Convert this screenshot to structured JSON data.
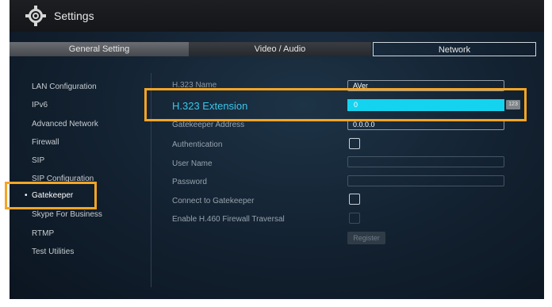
{
  "window": {
    "title": "Settings",
    "icon": "gear-icon"
  },
  "tabs": [
    {
      "label": "General Setting",
      "selected": false
    },
    {
      "label": "Video / Audio",
      "selected": false
    },
    {
      "label": "Network",
      "selected": true
    }
  ],
  "sidebar": {
    "items": [
      {
        "label": "LAN Configuration"
      },
      {
        "label": "IPv6"
      },
      {
        "label": "Advanced Network"
      },
      {
        "label": "Firewall"
      },
      {
        "label": "SIP"
      },
      {
        "label": "SIP Configuration"
      },
      {
        "label": "Gatekeeper",
        "active": true
      },
      {
        "label": "Skype For Business"
      },
      {
        "label": "RTMP"
      },
      {
        "label": "Test Utilities"
      }
    ]
  },
  "form": {
    "h323_name": {
      "label": "H.323 Name",
      "value": "AVer"
    },
    "h323_extension": {
      "label": "H.323 Extension",
      "value": "0",
      "input_badge": "123"
    },
    "gatekeeper_address": {
      "label": "Gatekeeper Address",
      "value": "0.0.0.0"
    },
    "authentication": {
      "label": "Authentication",
      "checked": false
    },
    "user_name": {
      "label": "User Name",
      "value": ""
    },
    "password": {
      "label": "Password",
      "value": ""
    },
    "connect_to_gatekeeper": {
      "label": "Connect to Gatekeeper",
      "checked": false
    },
    "enable_h460": {
      "label": "Enable H.460 Firewall Traversal",
      "checked": false,
      "enabled": false
    },
    "register_label": "Register"
  },
  "colors": {
    "highlight": "#f5a524",
    "accent": "#14d3ef"
  }
}
